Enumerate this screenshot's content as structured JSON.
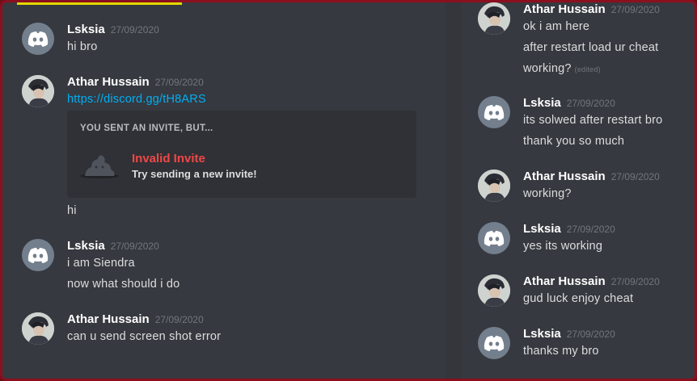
{
  "left_column": {
    "messages": [
      {
        "author": "Lsksia",
        "time": "27/09/2020",
        "avatar": "discord-default-avatar",
        "lines": [
          "hi bro"
        ]
      },
      {
        "author": "Athar Hussain",
        "time": "27/09/2020",
        "avatar": "user-photo-avatar",
        "link": "https://discord.gg/tH8ARS"
      },
      {
        "lines": [
          "hi"
        ]
      },
      {
        "author": "Lsksia",
        "time": "27/09/2020",
        "avatar": "discord-default-avatar",
        "lines": [
          "i am Siendra",
          "now what should i do"
        ]
      },
      {
        "author": "Athar Hussain",
        "time": "27/09/2020",
        "avatar": "user-photo-avatar",
        "lines": [
          "can u send screen shot error"
        ]
      }
    ],
    "invite_card": {
      "header": "YOU SENT AN INVITE, BUT...",
      "title": "Invalid Invite",
      "subtitle": "Try sending a new invite!",
      "icon": "invalid-invite-icon"
    }
  },
  "right_column": {
    "messages": [
      {
        "author": "Athar Hussain",
        "time": "27/09/2020",
        "avatar": "user-photo-avatar",
        "lines": [
          "ok i am here",
          "after restart load ur cheat",
          "working?"
        ],
        "edited": "(edited)"
      },
      {
        "author": "Lsksia",
        "time": "27/09/2020",
        "avatar": "discord-default-avatar",
        "lines": [
          "its solwed after restart bro",
          "thank you so much"
        ]
      },
      {
        "author": "Athar Hussain",
        "time": "27/09/2020",
        "avatar": "user-photo-avatar",
        "lines": [
          "working?"
        ]
      },
      {
        "author": "Lsksia",
        "time": "27/09/2020",
        "avatar": "discord-default-avatar",
        "lines": [
          "yes its working"
        ]
      },
      {
        "author": "Athar Hussain",
        "time": "27/09/2020",
        "avatar": "user-photo-avatar",
        "lines": [
          "gud luck enjoy cheat"
        ]
      },
      {
        "author": "Lsksia",
        "time": "27/09/2020",
        "avatar": "discord-default-avatar",
        "lines": [
          "thanks my bro"
        ]
      }
    ]
  },
  "colors": {
    "background": "#36393f",
    "border": "#8b0f1e",
    "username": "#ffffff",
    "timestamp": "#72767d",
    "text": "#dcddde",
    "link": "#00aff4",
    "invalid": "#f04747",
    "highlight": "#e3d800"
  }
}
